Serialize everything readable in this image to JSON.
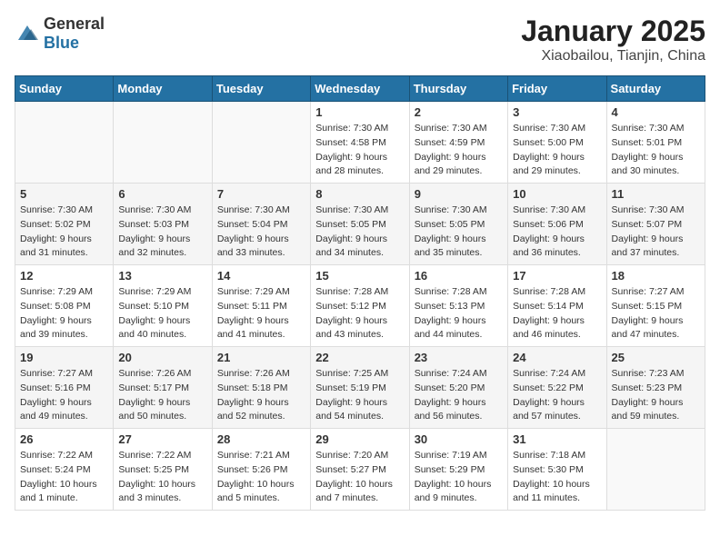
{
  "logo": {
    "general": "General",
    "blue": "Blue"
  },
  "title": "January 2025",
  "subtitle": "Xiaobailou, Tianjin, China",
  "headers": [
    "Sunday",
    "Monday",
    "Tuesday",
    "Wednesday",
    "Thursday",
    "Friday",
    "Saturday"
  ],
  "weeks": [
    [
      {
        "day": "",
        "sunrise": "",
        "sunset": "",
        "daylight": ""
      },
      {
        "day": "",
        "sunrise": "",
        "sunset": "",
        "daylight": ""
      },
      {
        "day": "",
        "sunrise": "",
        "sunset": "",
        "daylight": ""
      },
      {
        "day": "1",
        "sunrise": "Sunrise: 7:30 AM",
        "sunset": "Sunset: 4:58 PM",
        "daylight": "Daylight: 9 hours and 28 minutes."
      },
      {
        "day": "2",
        "sunrise": "Sunrise: 7:30 AM",
        "sunset": "Sunset: 4:59 PM",
        "daylight": "Daylight: 9 hours and 29 minutes."
      },
      {
        "day": "3",
        "sunrise": "Sunrise: 7:30 AM",
        "sunset": "Sunset: 5:00 PM",
        "daylight": "Daylight: 9 hours and 29 minutes."
      },
      {
        "day": "4",
        "sunrise": "Sunrise: 7:30 AM",
        "sunset": "Sunset: 5:01 PM",
        "daylight": "Daylight: 9 hours and 30 minutes."
      }
    ],
    [
      {
        "day": "5",
        "sunrise": "Sunrise: 7:30 AM",
        "sunset": "Sunset: 5:02 PM",
        "daylight": "Daylight: 9 hours and 31 minutes."
      },
      {
        "day": "6",
        "sunrise": "Sunrise: 7:30 AM",
        "sunset": "Sunset: 5:03 PM",
        "daylight": "Daylight: 9 hours and 32 minutes."
      },
      {
        "day": "7",
        "sunrise": "Sunrise: 7:30 AM",
        "sunset": "Sunset: 5:04 PM",
        "daylight": "Daylight: 9 hours and 33 minutes."
      },
      {
        "day": "8",
        "sunrise": "Sunrise: 7:30 AM",
        "sunset": "Sunset: 5:05 PM",
        "daylight": "Daylight: 9 hours and 34 minutes."
      },
      {
        "day": "9",
        "sunrise": "Sunrise: 7:30 AM",
        "sunset": "Sunset: 5:05 PM",
        "daylight": "Daylight: 9 hours and 35 minutes."
      },
      {
        "day": "10",
        "sunrise": "Sunrise: 7:30 AM",
        "sunset": "Sunset: 5:06 PM",
        "daylight": "Daylight: 9 hours and 36 minutes."
      },
      {
        "day": "11",
        "sunrise": "Sunrise: 7:30 AM",
        "sunset": "Sunset: 5:07 PM",
        "daylight": "Daylight: 9 hours and 37 minutes."
      }
    ],
    [
      {
        "day": "12",
        "sunrise": "Sunrise: 7:29 AM",
        "sunset": "Sunset: 5:08 PM",
        "daylight": "Daylight: 9 hours and 39 minutes."
      },
      {
        "day": "13",
        "sunrise": "Sunrise: 7:29 AM",
        "sunset": "Sunset: 5:10 PM",
        "daylight": "Daylight: 9 hours and 40 minutes."
      },
      {
        "day": "14",
        "sunrise": "Sunrise: 7:29 AM",
        "sunset": "Sunset: 5:11 PM",
        "daylight": "Daylight: 9 hours and 41 minutes."
      },
      {
        "day": "15",
        "sunrise": "Sunrise: 7:28 AM",
        "sunset": "Sunset: 5:12 PM",
        "daylight": "Daylight: 9 hours and 43 minutes."
      },
      {
        "day": "16",
        "sunrise": "Sunrise: 7:28 AM",
        "sunset": "Sunset: 5:13 PM",
        "daylight": "Daylight: 9 hours and 44 minutes."
      },
      {
        "day": "17",
        "sunrise": "Sunrise: 7:28 AM",
        "sunset": "Sunset: 5:14 PM",
        "daylight": "Daylight: 9 hours and 46 minutes."
      },
      {
        "day": "18",
        "sunrise": "Sunrise: 7:27 AM",
        "sunset": "Sunset: 5:15 PM",
        "daylight": "Daylight: 9 hours and 47 minutes."
      }
    ],
    [
      {
        "day": "19",
        "sunrise": "Sunrise: 7:27 AM",
        "sunset": "Sunset: 5:16 PM",
        "daylight": "Daylight: 9 hours and 49 minutes."
      },
      {
        "day": "20",
        "sunrise": "Sunrise: 7:26 AM",
        "sunset": "Sunset: 5:17 PM",
        "daylight": "Daylight: 9 hours and 50 minutes."
      },
      {
        "day": "21",
        "sunrise": "Sunrise: 7:26 AM",
        "sunset": "Sunset: 5:18 PM",
        "daylight": "Daylight: 9 hours and 52 minutes."
      },
      {
        "day": "22",
        "sunrise": "Sunrise: 7:25 AM",
        "sunset": "Sunset: 5:19 PM",
        "daylight": "Daylight: 9 hours and 54 minutes."
      },
      {
        "day": "23",
        "sunrise": "Sunrise: 7:24 AM",
        "sunset": "Sunset: 5:20 PM",
        "daylight": "Daylight: 9 hours and 56 minutes."
      },
      {
        "day": "24",
        "sunrise": "Sunrise: 7:24 AM",
        "sunset": "Sunset: 5:22 PM",
        "daylight": "Daylight: 9 hours and 57 minutes."
      },
      {
        "day": "25",
        "sunrise": "Sunrise: 7:23 AM",
        "sunset": "Sunset: 5:23 PM",
        "daylight": "Daylight: 9 hours and 59 minutes."
      }
    ],
    [
      {
        "day": "26",
        "sunrise": "Sunrise: 7:22 AM",
        "sunset": "Sunset: 5:24 PM",
        "daylight": "Daylight: 10 hours and 1 minute."
      },
      {
        "day": "27",
        "sunrise": "Sunrise: 7:22 AM",
        "sunset": "Sunset: 5:25 PM",
        "daylight": "Daylight: 10 hours and 3 minutes."
      },
      {
        "day": "28",
        "sunrise": "Sunrise: 7:21 AM",
        "sunset": "Sunset: 5:26 PM",
        "daylight": "Daylight: 10 hours and 5 minutes."
      },
      {
        "day": "29",
        "sunrise": "Sunrise: 7:20 AM",
        "sunset": "Sunset: 5:27 PM",
        "daylight": "Daylight: 10 hours and 7 minutes."
      },
      {
        "day": "30",
        "sunrise": "Sunrise: 7:19 AM",
        "sunset": "Sunset: 5:29 PM",
        "daylight": "Daylight: 10 hours and 9 minutes."
      },
      {
        "day": "31",
        "sunrise": "Sunrise: 7:18 AM",
        "sunset": "Sunset: 5:30 PM",
        "daylight": "Daylight: 10 hours and 11 minutes."
      },
      {
        "day": "",
        "sunrise": "",
        "sunset": "",
        "daylight": ""
      }
    ]
  ]
}
